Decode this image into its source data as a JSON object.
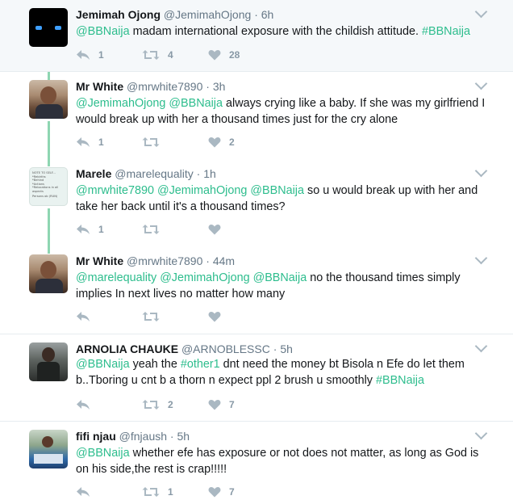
{
  "tweets": [
    {
      "name": "Jemimah Ojong",
      "handle": "@JemimahOjong",
      "dot": "·",
      "time": "6h",
      "text_parts": [
        {
          "t": "@BBNaija",
          "link": true
        },
        {
          "t": " madam international exposure with the childish attitude. ",
          "link": false
        },
        {
          "t": "#BBNaija",
          "link": true
        }
      ],
      "reply_count": "1",
      "retweet_count": "4",
      "like_count": "28"
    },
    {
      "name": "Mr White",
      "handle": "@mrwhite7890",
      "dot": "·",
      "time": "3h",
      "text_parts": [
        {
          "t": "@JemimahOjong",
          "link": true
        },
        {
          "t": " ",
          "link": false
        },
        {
          "t": "@BBNaija",
          "link": true
        },
        {
          "t": " always crying like a baby. If she was my girlfriend I would break up with her a thousand times just for the cry alone",
          "link": false
        }
      ],
      "reply_count": "1",
      "retweet_count": "",
      "like_count": "2"
    },
    {
      "name": "Marele",
      "handle": "@marelequality",
      "dot": "·",
      "time": "1h",
      "text_parts": [
        {
          "t": "@mrwhite7890",
          "link": true
        },
        {
          "t": " ",
          "link": false
        },
        {
          "t": "@JemimahOjong",
          "link": true
        },
        {
          "t": " ",
          "link": false
        },
        {
          "t": "@BBNaija",
          "link": true
        },
        {
          "t": " so u would break up with her and take her back until it's a thousand times?",
          "link": false
        }
      ],
      "reply_count": "1",
      "retweet_count": "",
      "like_count": ""
    },
    {
      "name": "Mr White",
      "handle": "@mrwhite7890",
      "dot": "·",
      "time": "44m",
      "text_parts": [
        {
          "t": "@marelequality",
          "link": true
        },
        {
          "t": " ",
          "link": false
        },
        {
          "t": "@JemimahOjong",
          "link": true
        },
        {
          "t": " ",
          "link": false
        },
        {
          "t": "@BBNaija",
          "link": true
        },
        {
          "t": " no the thousand times simply implies In next lives no matter how many",
          "link": false
        }
      ],
      "reply_count": "",
      "retweet_count": "",
      "like_count": ""
    },
    {
      "name": "ARNOLIA CHAUKE",
      "handle": "@ARNOBLESSC",
      "dot": "·",
      "time": "5h",
      "text_parts": [
        {
          "t": "@BBNaija",
          "link": true
        },
        {
          "t": " yeah the ",
          "link": false
        },
        {
          "t": "#other1",
          "link": true
        },
        {
          "t": " dnt need the money bt Bisola n Efe do let them b..Tboring u cnt b a thorn n expect ppl 2 brush u smoothly ",
          "link": false
        },
        {
          "t": "#BBNaija",
          "link": true
        }
      ],
      "reply_count": "",
      "retweet_count": "2",
      "like_count": "7"
    },
    {
      "name": "fifi njau",
      "handle": "@fnjaush",
      "dot": "·",
      "time": "5h",
      "text_parts": [
        {
          "t": "@BBNaija",
          "link": true
        },
        {
          "t": " whether efe has exposure or not does not matter, as long as God is on his side,the rest is crap!!!!!",
          "link": false
        }
      ],
      "reply_count": "",
      "retweet_count": "1",
      "like_count": "7"
    }
  ],
  "avatar_note_lines": [
    "NOTE TO SELF...",
    "*Rebirths",
    "*Behind",
    "*Actions",
    "*Relocations in all aspects",
    "Persons ob (RUN)"
  ],
  "colors": {
    "link": "#2dbd8d",
    "thread": "#8ed6b2",
    "icon": "#aab8c2",
    "first_bg": "#f5f8fa"
  }
}
